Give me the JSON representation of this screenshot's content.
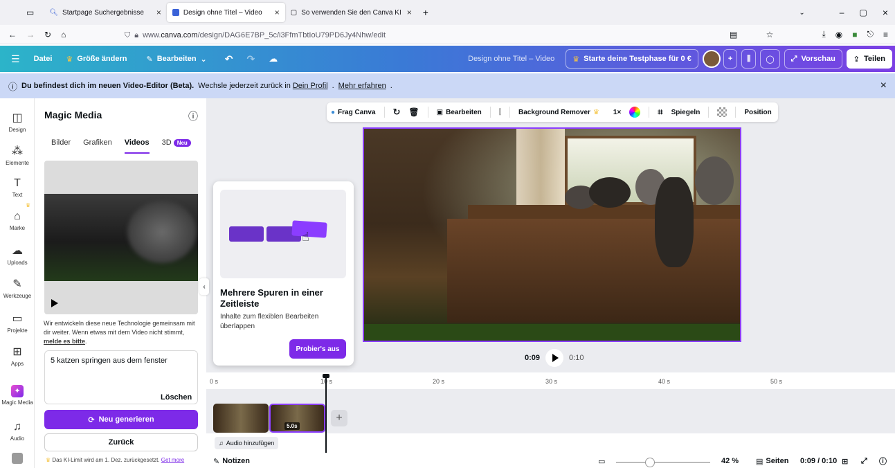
{
  "browser": {
    "tabs": [
      {
        "title": "Startpage Suchergebnisse",
        "active": false
      },
      {
        "title": "Design ohne Titel – Video",
        "active": true
      },
      {
        "title": "So verwenden Sie den Canva KI",
        "active": false
      }
    ],
    "url_prefix": "www.",
    "url_domain": "canva.com",
    "url_path": "/design/DAG6E7BP_5c/i3FfmTbtIoU79PD6Jy4Nhw/edit"
  },
  "toolbar": {
    "datei": "Datei",
    "resize": "Größe ändern",
    "edit": "Bearbeiten",
    "doc_title": "Design ohne Titel – Video",
    "trial": "Starte deine Testphase für 0 €",
    "preview": "Vorschau",
    "share": "Teilen"
  },
  "banner": {
    "bold": "Du befindest dich im neuen Video-Editor (Beta).",
    "text": "Wechsle jederzeit zurück in",
    "link1": "Dein Profil",
    "link2": "Mehr erfahren"
  },
  "rail": [
    {
      "label": "Design",
      "icon": "design-icon"
    },
    {
      "label": "Elemente",
      "icon": "elements-icon"
    },
    {
      "label": "Text",
      "icon": "text-icon"
    },
    {
      "label": "Marke",
      "icon": "brand-icon"
    },
    {
      "label": "Uploads",
      "icon": "upload-icon"
    },
    {
      "label": "Werkzeuge",
      "icon": "tools-icon"
    },
    {
      "label": "Projekte",
      "icon": "folder-icon"
    },
    {
      "label": "Apps",
      "icon": "apps-icon"
    },
    {
      "label": "Magic Media",
      "icon": "magic-media-icon"
    },
    {
      "label": "Audio",
      "icon": "audio-icon"
    }
  ],
  "panel": {
    "title": "Magic Media",
    "tabs": [
      "Bilder",
      "Grafiken",
      "Videos",
      "3D"
    ],
    "neu_badge": "Neu",
    "description": "Wir entwickeln diese neue Technologie gemeinsam mit dir weiter. Wenn etwas mit dem Video nicht stimmt,",
    "report_link": "melde es bitte",
    "prompt": "5 katzen springen aus dem fenster",
    "clear": "Löschen",
    "regenerate": "Neu generieren",
    "back": "Zurück",
    "limit_text": "Das KI-Limit wird am 1. Dez. zurückgesetzt.",
    "limit_link": "Get more"
  },
  "context_bar": {
    "ask": "Frag Canva",
    "edit": "Bearbeiten",
    "bg_remover": "Background Remover",
    "speed": "1×",
    "flip": "Spiegeln",
    "position": "Position"
  },
  "tooltip": {
    "title": "Mehrere Spuren in einer Zeitleiste",
    "text": "Inhalte zum flexiblen Bearbeiten überlappen",
    "button": "Probier's aus"
  },
  "playback": {
    "current": "0:09",
    "total": "0:10"
  },
  "timeline": {
    "ticks": [
      "0 s",
      "10 s",
      "20 s",
      "30 s",
      "40 s",
      "50 s"
    ],
    "clip_duration": "5.0s",
    "add_audio": "Audio hinzufügen"
  },
  "footer": {
    "notes": "Notizen",
    "zoom": "42 %",
    "pages": "Seiten",
    "time": "0:09 / 0:10"
  },
  "colors": {
    "accent": "#7d2ae8",
    "selection": "#8b3dff",
    "banner": "#cbd8f6"
  }
}
